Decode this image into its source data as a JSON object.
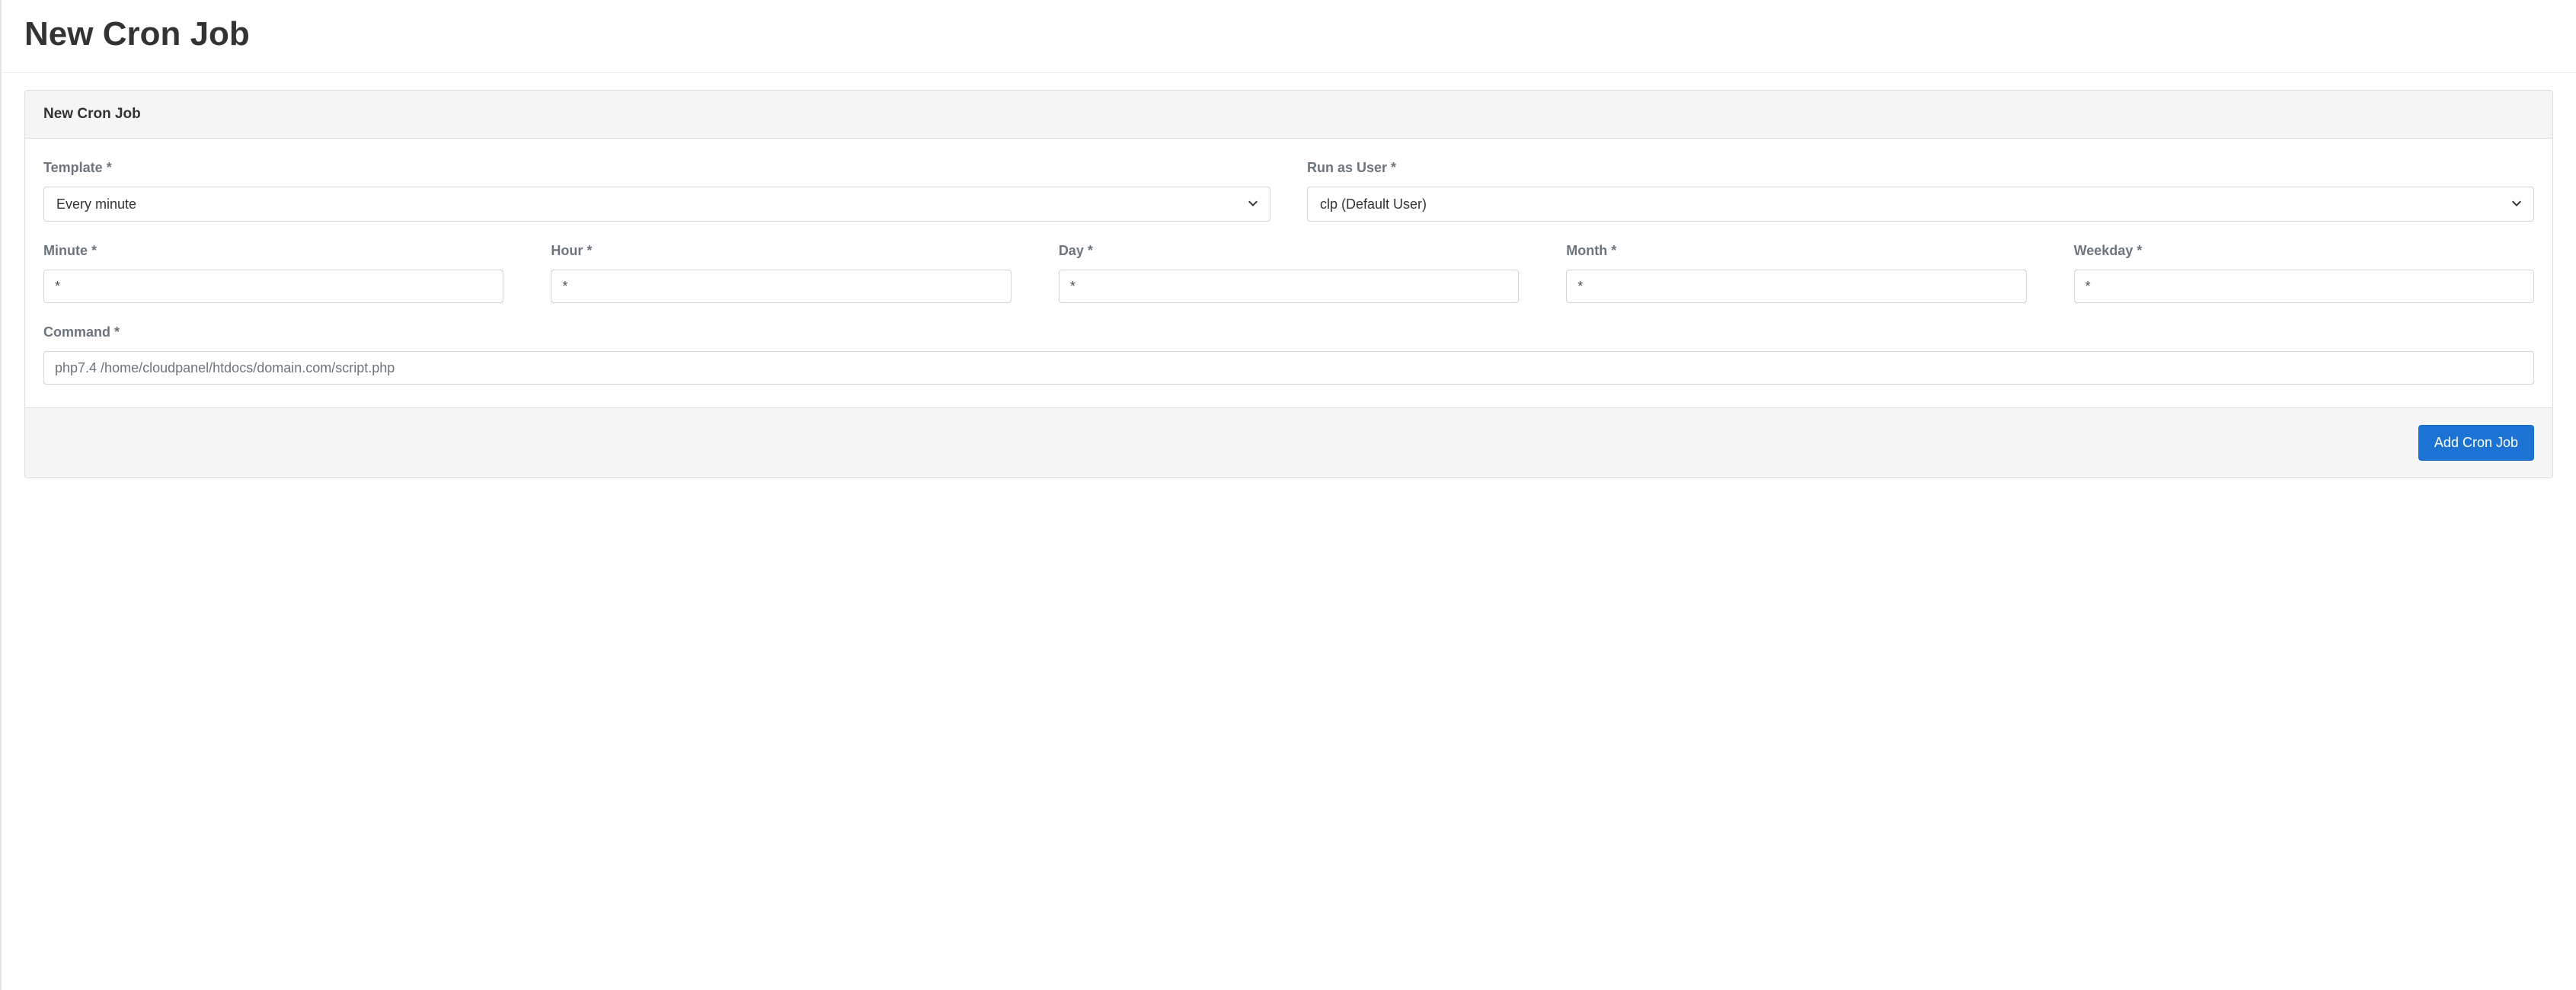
{
  "page": {
    "title": "New Cron Job"
  },
  "panel": {
    "header_title": "New Cron Job"
  },
  "fields": {
    "template": {
      "label": "Template *",
      "selected": "Every minute"
    },
    "run_as_user": {
      "label": "Run as User *",
      "selected": "clp (Default User)"
    },
    "minute": {
      "label": "Minute *",
      "value": "*"
    },
    "hour": {
      "label": "Hour *",
      "value": "*"
    },
    "day": {
      "label": "Day *",
      "value": "*"
    },
    "month": {
      "label": "Month *",
      "value": "*"
    },
    "weekday": {
      "label": "Weekday *",
      "value": "*"
    },
    "command": {
      "label": "Command *",
      "placeholder": "php7.4 /home/cloudpanel/htdocs/domain.com/script.php",
      "value": ""
    }
  },
  "actions": {
    "submit_label": "Add Cron Job"
  }
}
